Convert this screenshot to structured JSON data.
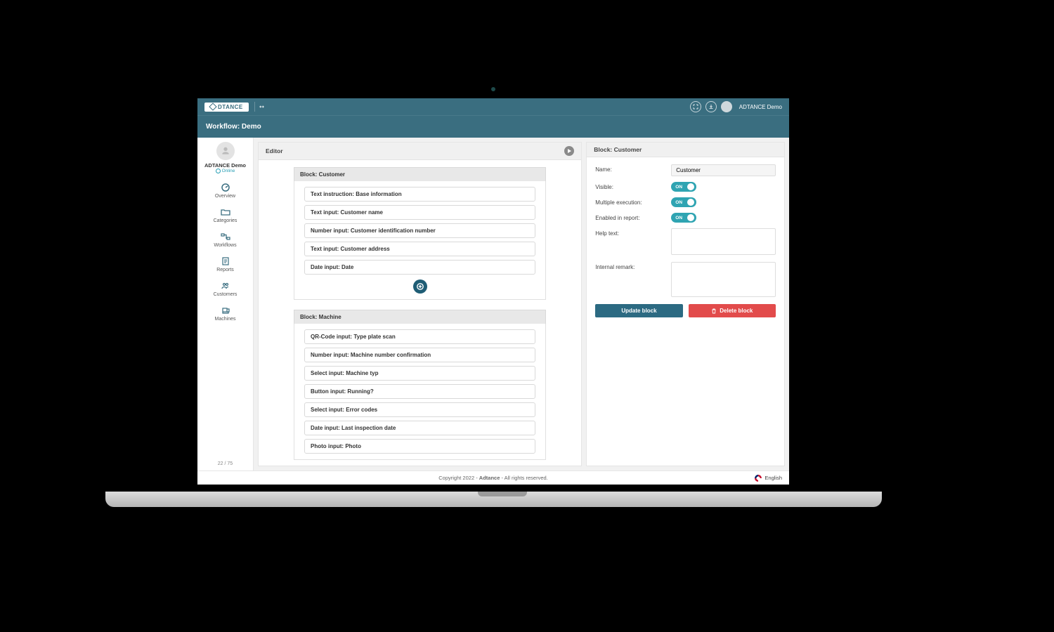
{
  "brand": "DTANCE",
  "topbar": {
    "user": "ADTANCE Demo"
  },
  "header": {
    "title": "Workflow: Demo"
  },
  "sidebar": {
    "user_name": "ADTANCE Demo",
    "status": "Online",
    "items": [
      {
        "label": "Overview"
      },
      {
        "label": "Categories"
      },
      {
        "label": "Workflows"
      },
      {
        "label": "Reports"
      },
      {
        "label": "Customers"
      },
      {
        "label": "Machines"
      }
    ],
    "pager": "22 / 75"
  },
  "editor": {
    "panel_title": "Editor",
    "blocks": [
      {
        "title": "Block: Customer",
        "items": [
          "Text instruction: Base information",
          "Text input: Customer name",
          "Number input: Customer identification number",
          "Text input: Customer address",
          "Date input: Date"
        ],
        "show_add": true
      },
      {
        "title": "Block: Machine",
        "items": [
          "QR-Code input: Type plate scan",
          "Number input: Machine number confirmation",
          "Select input: Machine typ",
          "Button input: Running?",
          "Select input: Error codes",
          "Date input: Last inspection date",
          "Photo input: Photo"
        ],
        "show_add": false
      }
    ]
  },
  "properties": {
    "panel_title": "Block: Customer",
    "name_label": "Name:",
    "name_value": "Customer",
    "visible_label": "Visible:",
    "visible_toggle": "ON",
    "multi_label": "Multiple execution:",
    "multi_toggle": "ON",
    "enabled_label": "Enabled in report:",
    "enabled_toggle": "ON",
    "help_label": "Help text:",
    "remark_label": "Internal remark:",
    "update_btn": "Update block",
    "delete_btn": "Delete block"
  },
  "footer": {
    "copyright_pre": "Copyright 2022 - ",
    "copyright_strong": "Adtance",
    "copyright_post": " - All rights reserved.",
    "language": "English"
  }
}
